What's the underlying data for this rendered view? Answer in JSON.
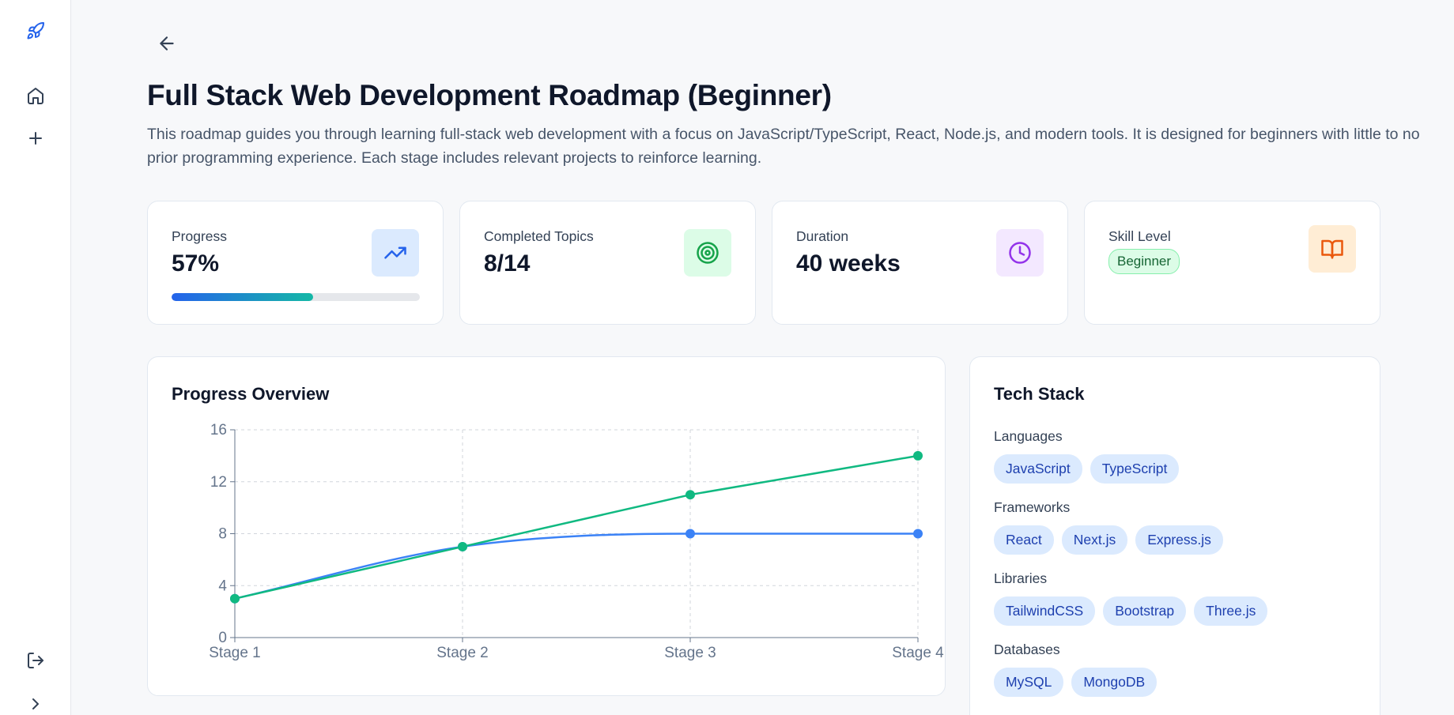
{
  "sidebar": {
    "items": [
      {
        "icon": "rocket-icon"
      },
      {
        "icon": "home-icon"
      },
      {
        "icon": "plus-icon"
      },
      {
        "icon": "logout-icon"
      },
      {
        "icon": "chevron-right-icon"
      }
    ]
  },
  "header": {
    "title": "Full Stack Web Development Roadmap (Beginner)",
    "description": "This roadmap guides you through learning full-stack web development with a focus on JavaScript/TypeScript, React, Node.js, and modern tools. It is designed for beginners with little to no prior programming experience. Each stage includes relevant projects to reinforce learning."
  },
  "stats": {
    "progress": {
      "label": "Progress",
      "value": "57%",
      "fraction": 0.57,
      "icon": "trending-up-icon",
      "color": "#2563eb"
    },
    "completed": {
      "label": "Completed Topics",
      "value": "8/14",
      "icon": "target-icon",
      "color": "#16a34a"
    },
    "duration": {
      "label": "Duration",
      "value": "40 weeks",
      "icon": "clock-icon",
      "color": "#9333ea"
    },
    "skill": {
      "label": "Skill Level",
      "value": "Beginner",
      "icon": "book-open-icon",
      "color": "#ea580c"
    }
  },
  "progress_overview": {
    "title": "Progress Overview"
  },
  "chart_data": {
    "type": "line",
    "categories": [
      "Stage 1",
      "Stage 2",
      "Stage 3",
      "Stage 4"
    ],
    "series": [
      {
        "values": [
          3,
          7,
          8,
          8
        ],
        "color": "#3b82f6",
        "curve": "smooth"
      },
      {
        "values": [
          3,
          7,
          11,
          14
        ],
        "color": "#10b981",
        "curve": "linear"
      }
    ],
    "ylim": [
      0,
      16
    ],
    "yticks": [
      0,
      4,
      8,
      12,
      16
    ],
    "grid": true
  },
  "tech_stack": {
    "title": "Tech Stack",
    "groups": [
      {
        "label": "Languages",
        "items": [
          "JavaScript",
          "TypeScript"
        ]
      },
      {
        "label": "Frameworks",
        "items": [
          "React",
          "Next.js",
          "Express.js"
        ]
      },
      {
        "label": "Libraries",
        "items": [
          "TailwindCSS",
          "Bootstrap",
          "Three.js"
        ]
      },
      {
        "label": "Databases",
        "items": [
          "MySQL",
          "MongoDB"
        ]
      }
    ]
  }
}
